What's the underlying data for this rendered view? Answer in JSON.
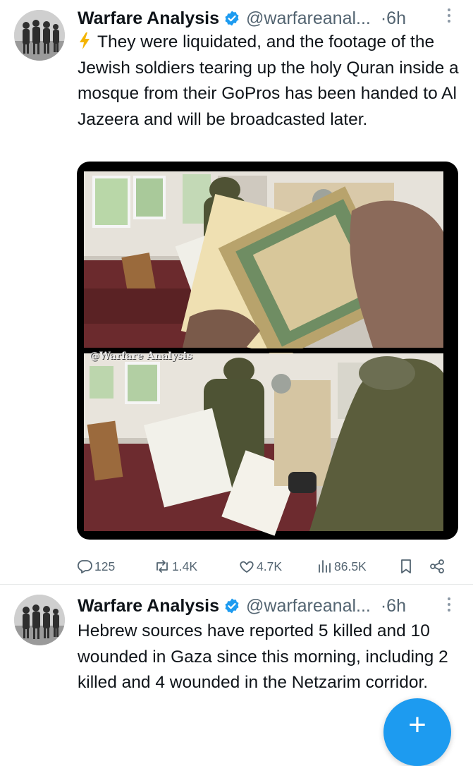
{
  "tweets": [
    {
      "author": "Warfare Analysis",
      "handle": "@warfareanal...",
      "time": "·6h",
      "text": "They were liquidated, and the footage of the Jewish soldiers tearing up the holy Quran inside a mosque from their GoPros has been handed to Al Jazeera and will be broadcasted later.",
      "media_watermark": "@Warfare Analysis",
      "stats": {
        "replies": "125",
        "reposts": "1.4K",
        "likes": "4.7K",
        "views": "86.5K"
      }
    },
    {
      "author": "Warfare Analysis",
      "handle": "@warfareanal...",
      "time": "·6h",
      "text": "Hebrew sources have reported 5 killed and 10 wounded in Gaza since this morning, including 2 killed and 4 wounded in the Netzarim corridor."
    }
  ],
  "fab": {
    "label": "+"
  },
  "colors": {
    "accent": "#1d9bf0",
    "secondary_text": "#536471",
    "primary_text": "#0f1419",
    "bolt": "#f4b400"
  },
  "icons": [
    "verified-badge-icon",
    "lightning-bolt-icon",
    "more-icon",
    "reply-icon",
    "repost-icon",
    "like-icon",
    "views-icon",
    "bookmark-icon",
    "share-icon",
    "compose-icon"
  ]
}
